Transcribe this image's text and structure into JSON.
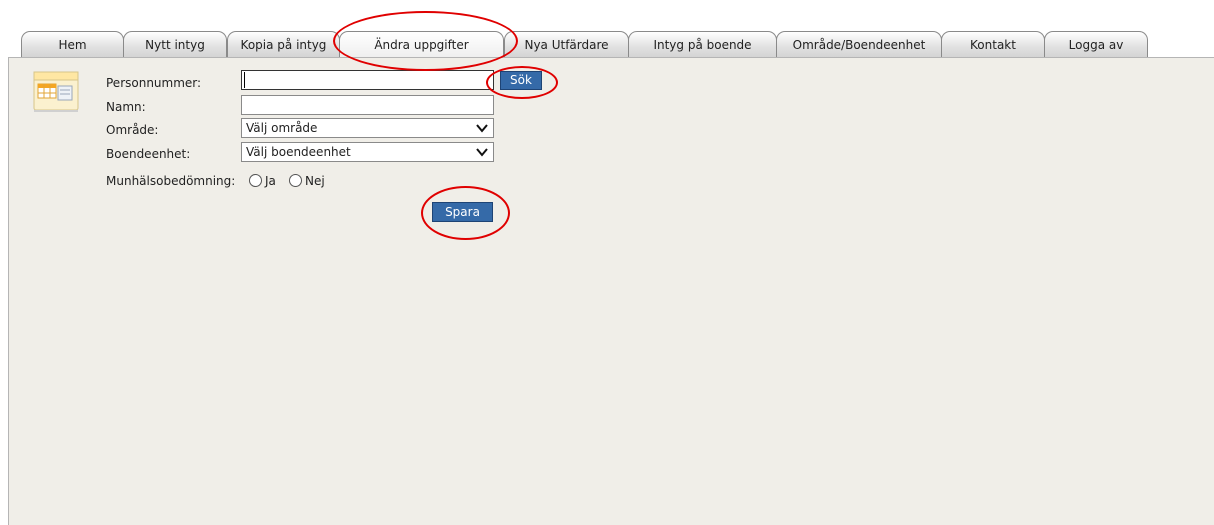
{
  "tabs": [
    {
      "label": "Hem"
    },
    {
      "label": "Nytt intyg"
    },
    {
      "label": "Kopia på intyg"
    },
    {
      "label": "Ändra uppgifter"
    },
    {
      "label": "Nya Utfärdare"
    },
    {
      "label": "Intyg på boende"
    },
    {
      "label": "Område/Boendeenhet"
    },
    {
      "label": "Kontakt"
    },
    {
      "label": "Logga av"
    }
  ],
  "active_tab": "Ändra uppgifter",
  "form": {
    "personnummer_label": "Personnummer:",
    "personnummer_value": "",
    "search_button": "Sök",
    "namn_label": "Namn:",
    "namn_value": "",
    "omrade_label": "Område:",
    "omrade_selected": "Välj område",
    "boendeenhet_label": "Boendeenhet:",
    "boendeenhet_selected": "Välj boendeenhet",
    "munhalso_label": "Munhälsobedömning:",
    "option_yes": "Ja",
    "option_no": "Nej",
    "save_button": "Spara"
  },
  "icons": {
    "page_icon": "folder-table-icon",
    "dropdown": "chevron-down-icon"
  },
  "colors": {
    "content_bg": "#f0eee8",
    "button_bg": "#356aa8",
    "highlight_ring": "#e00000"
  }
}
